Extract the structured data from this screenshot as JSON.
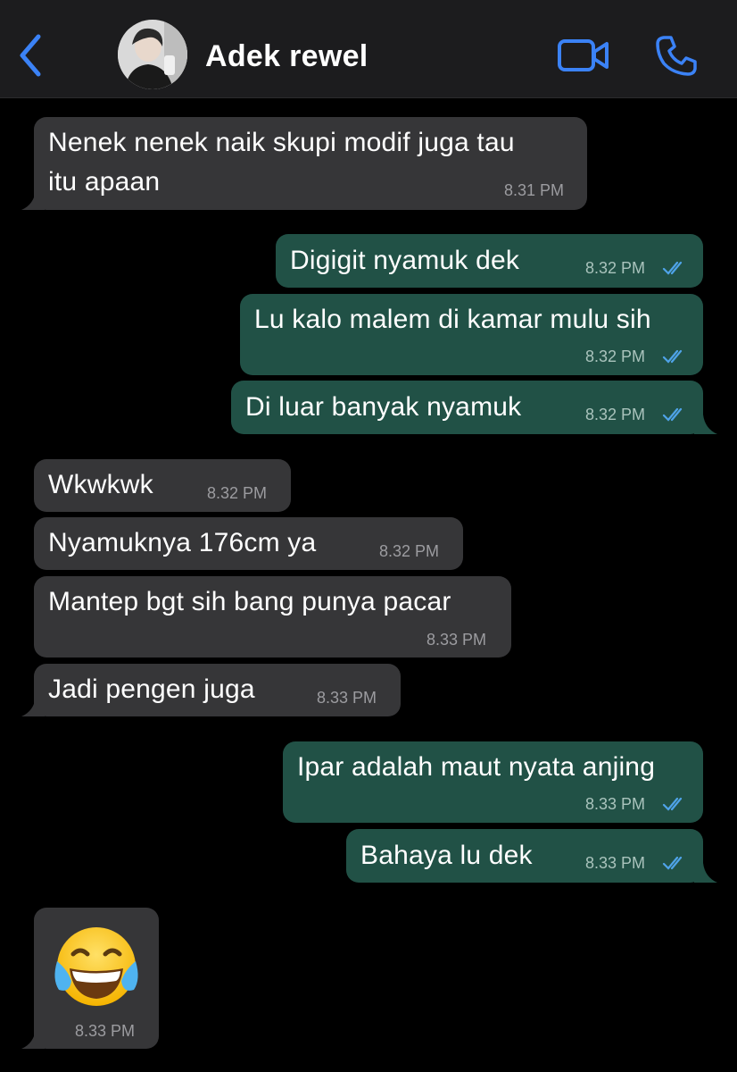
{
  "header": {
    "contact_name": "Adek rewel",
    "back_icon": "chevron-left-icon",
    "video_icon": "video-camera-icon",
    "call_icon": "phone-icon",
    "accent_color": "#3b82f6"
  },
  "messages": [
    {
      "side": "in",
      "lines": [
        "Nenek nenek naik skupi modif juga tau",
        "itu apaan"
      ],
      "time": "8.31 PM"
    },
    {
      "side": "out",
      "lines": [
        "Digigit nyamuk dek"
      ],
      "time": "8.32 PM",
      "read": true
    },
    {
      "side": "out",
      "lines": [
        "Lu kalo malem di kamar mulu sih"
      ],
      "time": "8.32 PM",
      "read": true
    },
    {
      "side": "out",
      "lines": [
        "Di luar banyak nyamuk"
      ],
      "time": "8.32 PM",
      "read": true
    },
    {
      "side": "in",
      "lines": [
        "Wkwkwk"
      ],
      "time": "8.32 PM"
    },
    {
      "side": "in",
      "lines": [
        "Nyamuknya 176cm ya"
      ],
      "time": "8.32 PM"
    },
    {
      "side": "in",
      "lines": [
        "Mantep bgt sih bang punya pacar"
      ],
      "time": "8.33 PM"
    },
    {
      "side": "in",
      "lines": [
        "Jadi pengen juga"
      ],
      "time": "8.33 PM"
    },
    {
      "side": "out",
      "lines": [
        "Ipar adalah maut nyata anjing"
      ],
      "time": "8.33 PM",
      "read": true
    },
    {
      "side": "out",
      "lines": [
        "Bahaya lu dek"
      ],
      "time": "8.33 PM",
      "read": true
    },
    {
      "side": "in",
      "emoji": "face-with-tears-of-joy",
      "time": "8.33 PM"
    }
  ],
  "colors": {
    "incoming_bubble": "#363638",
    "outgoing_bubble": "#215146",
    "read_ticks": "#4fa3e8"
  }
}
